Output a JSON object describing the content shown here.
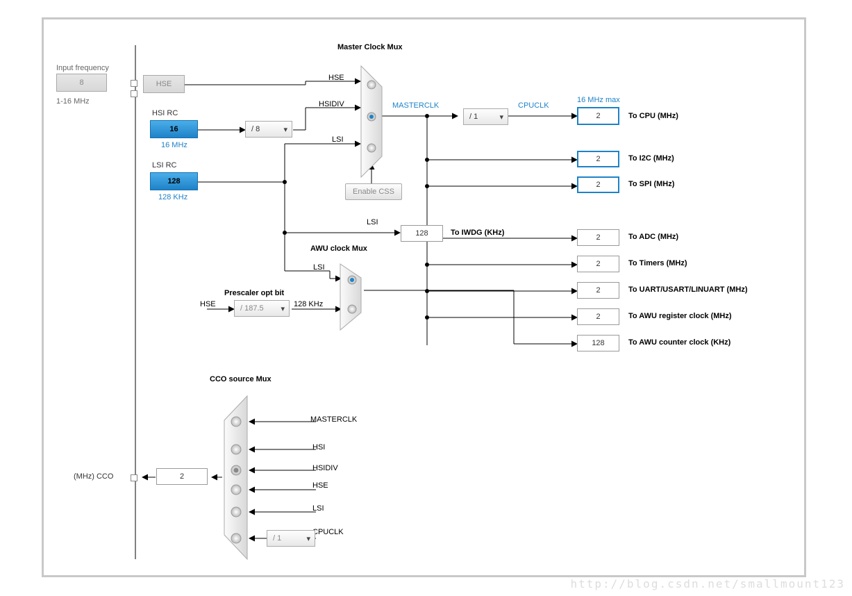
{
  "input": {
    "label": "Input frequency",
    "value": "8",
    "range": "1-16 MHz"
  },
  "hse": {
    "label": "HSE"
  },
  "hsirc": {
    "label": "HSI RC",
    "value": "16",
    "unit": "16 MHz"
  },
  "hsidiv": {
    "value": "/ 8"
  },
  "lsirc": {
    "label": "LSI RC",
    "value": "128",
    "unit": "128 KHz"
  },
  "mastermux": {
    "title": "Master Clock Mux",
    "sig_hse": "HSE",
    "sig_hsidiv": "HSIDIV",
    "sig_lsi": "LSI"
  },
  "enablecss": {
    "label": "Enable CSS"
  },
  "masterclk_lbl": "MASTERCLK",
  "cpudiv": {
    "value": "/ 1"
  },
  "cpuclk_lbl": "CPUCLK",
  "maxnote": "16 MHz max",
  "out_cpu": {
    "value": "2",
    "label": "To CPU (MHz)"
  },
  "out_i2c": {
    "value": "2",
    "label": "To I2C (MHz)"
  },
  "out_spi": {
    "value": "2",
    "label": "To SPI (MHz)"
  },
  "out_iwdg": {
    "value": "128",
    "label": "To IWDG (KHz)",
    "sig": "LSI"
  },
  "out_adc": {
    "value": "2",
    "label": "To ADC (MHz)"
  },
  "out_tim": {
    "value": "2",
    "label": "To Timers (MHz)"
  },
  "out_uart": {
    "value": "2",
    "label": "To UART/USART/LINUART (MHz)"
  },
  "out_awureg": {
    "value": "2",
    "label": "To AWU register clock (MHz)"
  },
  "out_awucnt": {
    "value": "128",
    "label": "To AWU counter clock (KHz)"
  },
  "awumux": {
    "title": "AWU clock Mux",
    "sig_lsi": "LSI",
    "presc_lbl": "Prescaler opt bit",
    "sig_hse": "HSE",
    "khz": "128 KHz",
    "div": "/ 187.5"
  },
  "ccomux": {
    "title": "CCO source Mux",
    "inputs": [
      "MASTERCLK",
      "HSI",
      "HSIDIV",
      "HSE",
      "LSI",
      "CPUCLK"
    ],
    "div": "/ 1"
  },
  "ccoout": {
    "value": "2",
    "label": "(MHz) CCO"
  },
  "watermark": "http://blog.csdn.net/smallmount123"
}
